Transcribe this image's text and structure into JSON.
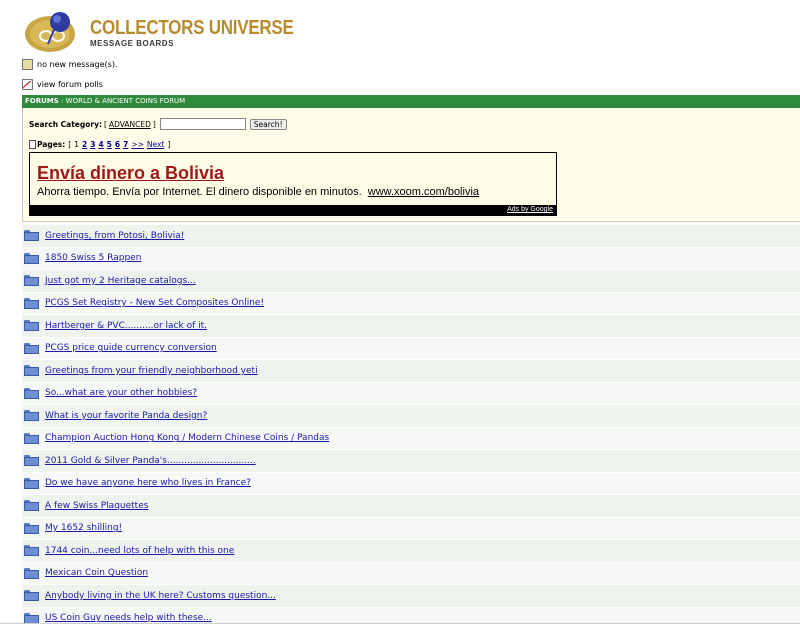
{
  "header": {
    "logo_title": "COLLECTORS UNIVERSE",
    "logo_subtitle": "Message Boards",
    "messages_status": "no new message(s).",
    "polls_link": "view forum polls"
  },
  "breadcrumb": {
    "forums": "FORUMS",
    "separator": ":",
    "forum_name": "WORLD & ANCIENT COINS FORUM"
  },
  "search": {
    "label": "Search Category:",
    "bracket_open": "[",
    "advanced": "ADVANCED",
    "bracket_close": "]",
    "input_value": "",
    "button": "Search!"
  },
  "pages": {
    "label": "Pages:",
    "bracket_open": "[",
    "items": [
      "1",
      "2",
      "3",
      "4",
      "5",
      "6",
      "7",
      ">>"
    ],
    "next": "Next",
    "bracket_close": "]"
  },
  "ad": {
    "title": "Envía dinero a Bolivia",
    "description": "Ahorra tiempo. Envía por Internet. El dinero disponible en minutos.",
    "url": "www.xoom.com/bolivia",
    "footer": "Ads by Google"
  },
  "threads": [
    "Greetings, from Potosi, Bolivia!",
    "1850 Swiss 5 Rappen",
    "Just got my 2 Heritage catalogs...",
    "PCGS Set Registry - New Set Composites Online!",
    "Hartberger & PVC..........or lack of it.",
    "PCGS price guide currency conversion",
    "Greetings from your friendly neighborhood yeti",
    "So...what are your other hobbies?",
    "What is your favorite Panda design?",
    "Champion Auction Hong Kong / Modern Chinese Coins / Pandas",
    "2011 Gold & Silver Panda's...............................",
    "Do we have anyone here who lives in France?",
    "A few Swiss Plaquettes",
    "My 1652 shilling!",
    "1744 coin...need lots of help with this one",
    "Mexican Coin Question",
    "Anybody living in the UK here? Customs question...",
    "US Coin Guy needs help with these..."
  ],
  "colors": {
    "green_bar": "#2f8a3c",
    "panel_bg": "#fffde8",
    "ad_title": "#a01818",
    "link": "#1a1aa6",
    "logo_gold": "#b98b2f"
  }
}
